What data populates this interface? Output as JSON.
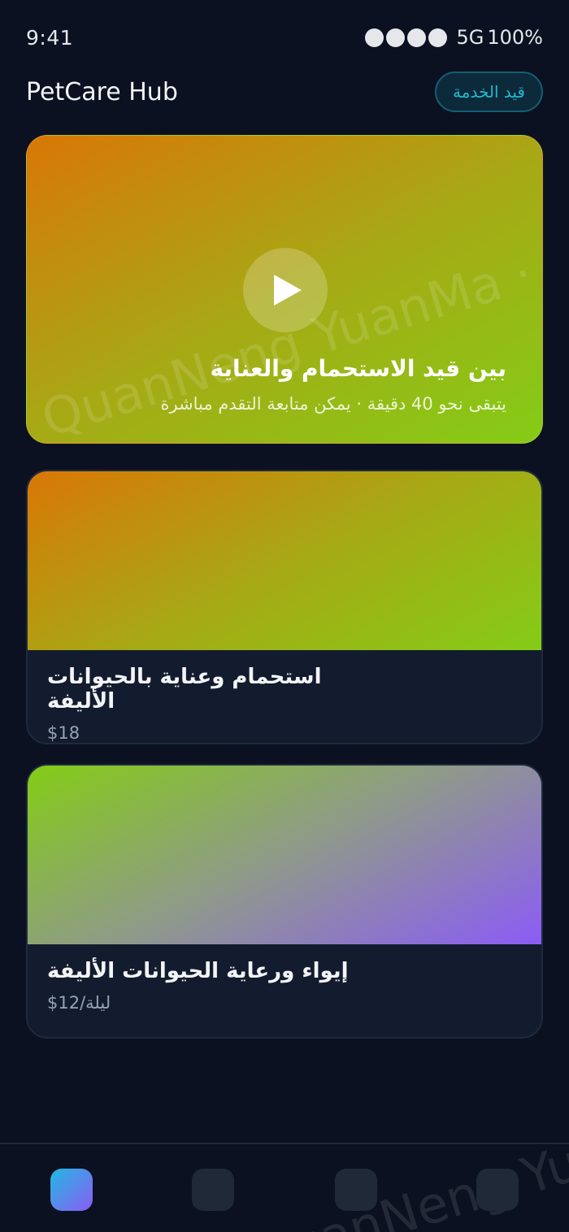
{
  "status_bar": {
    "time": "9:41",
    "network": "5G",
    "battery": "100%"
  },
  "header": {
    "app_title": "PetCare Hub",
    "status_pill": "قيد الخدمة"
  },
  "hero": {
    "title": "بين قيد الاستحمام والعناية",
    "subtitle": "يتبقى نحو 40 دقيقة · يمكن متابعة التقدم مباشرة",
    "watermark": "QuanNeng YuanMa · in",
    "play_icon": "play-icon"
  },
  "cards": [
    {
      "title": "استحمام وعناية بالحيوانات الأليفة",
      "price": "$18"
    },
    {
      "title": "إيواء ورعاية الحيوانات الأليفة",
      "price": "$12/ليلة"
    }
  ],
  "bottom_nav": {
    "watermark": "QuanNeng YuanMa",
    "items": [
      "home-nav",
      "orders-nav",
      "messages-nav",
      "profile-nav"
    ]
  },
  "colors": {
    "background": "#0b1120",
    "accent": "#22b8cf",
    "card": "#131c2e"
  }
}
